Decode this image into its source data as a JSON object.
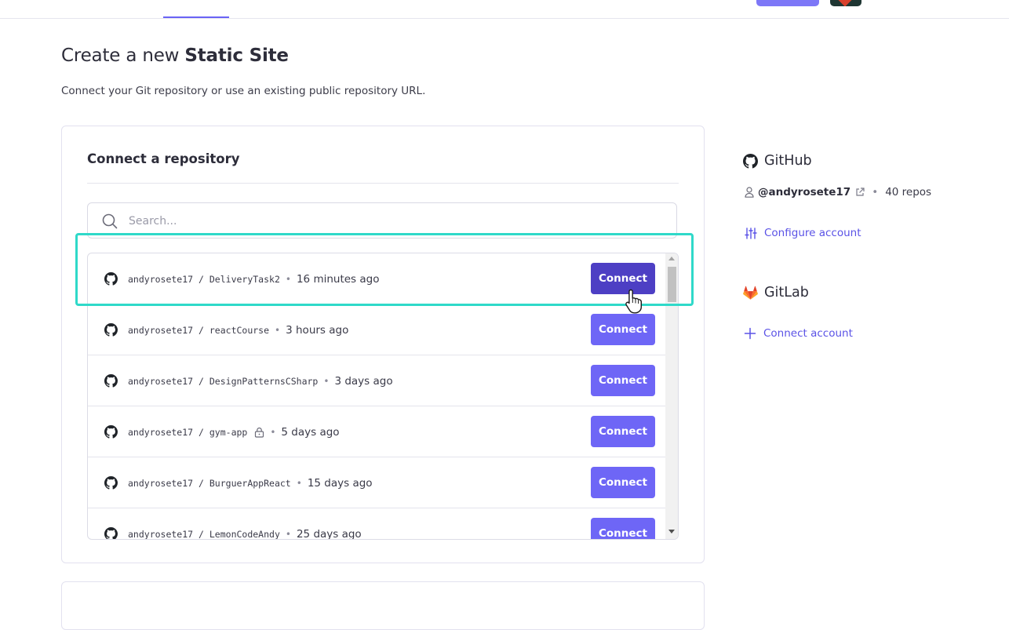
{
  "header": {
    "title_prefix": "Create a new ",
    "title_bold": "Static Site",
    "subtitle": "Connect your Git repository or use an existing public repository URL."
  },
  "connect_repo": {
    "title": "Connect a repository",
    "search_placeholder": "Search...",
    "connect_label": "Connect",
    "separator": "•",
    "repos": [
      {
        "owner": "andyrosete17",
        "name": "DeliveryTask2",
        "updated": "16 minutes ago",
        "private": false
      },
      {
        "owner": "andyrosete17",
        "name": "reactCourse",
        "updated": "3 hours ago",
        "private": false
      },
      {
        "owner": "andyrosete17",
        "name": "DesignPatternsCSharp",
        "updated": "3 days ago",
        "private": false
      },
      {
        "owner": "andyrosete17",
        "name": "gym-app",
        "updated": "5 days ago",
        "private": true
      },
      {
        "owner": "andyrosete17",
        "name": "BurguerAppReact",
        "updated": "15 days ago",
        "private": false
      },
      {
        "owner": "andyrosete17",
        "name": "LemonCodeAndy",
        "updated": "25 days ago",
        "private": false
      }
    ]
  },
  "sidebar": {
    "github": {
      "title": "GitHub",
      "handle": "@andyrosete17",
      "separator": "•",
      "repo_count": "40 repos",
      "configure_label": "Configure account"
    },
    "gitlab": {
      "title": "GitLab",
      "connect_label": "Connect account"
    }
  },
  "colors": {
    "accent": "#6e66f6",
    "accent_active": "#4d3fc4",
    "highlight": "#2fd9c9",
    "link": "#5a52e6",
    "gitlab_orange": "#e24329"
  },
  "icons": {
    "search": "search-icon",
    "github": "github-icon",
    "lock": "lock-icon",
    "user": "user-icon",
    "external_link": "external-link-icon",
    "settings_sliders": "sliders-icon",
    "gitlab": "gitlab-icon",
    "plus": "plus-icon",
    "cursor": "hand-cursor-icon"
  }
}
